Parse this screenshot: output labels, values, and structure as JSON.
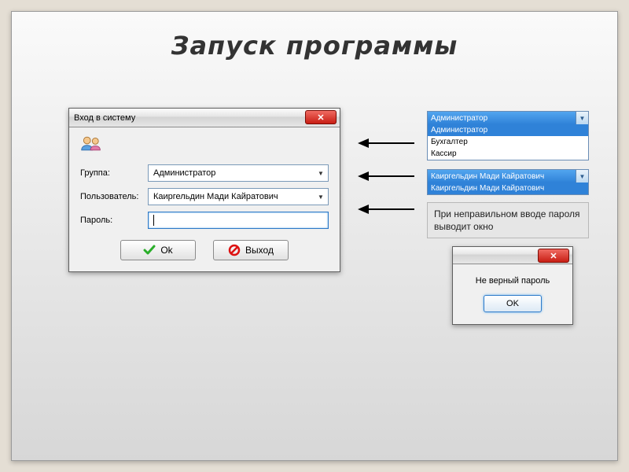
{
  "page_title": "Запуск программы",
  "login": {
    "title": "Вход в систему",
    "labels": {
      "group": "Группа:",
      "user": "Пользователь:",
      "password": "Пароль:"
    },
    "fields": {
      "group_value": "Администратор",
      "user_value": "Каиргельдин Мади Кайратович",
      "password_value": ""
    },
    "buttons": {
      "ok": "Ok",
      "exit": "Выход"
    }
  },
  "group_dropdown": {
    "selected": "Администратор",
    "options": [
      "Администратор",
      "Бухгалтер",
      "Кассир"
    ]
  },
  "user_dropdown": {
    "selected": "Каиргельдин Мади Кайратович",
    "options": [
      "Каиргельдин Мади Кайратович"
    ]
  },
  "info_text": "При неправильном вводе пароля выводит окно",
  "error_dialog": {
    "message": "Не верный пароль",
    "ok": "OK"
  }
}
